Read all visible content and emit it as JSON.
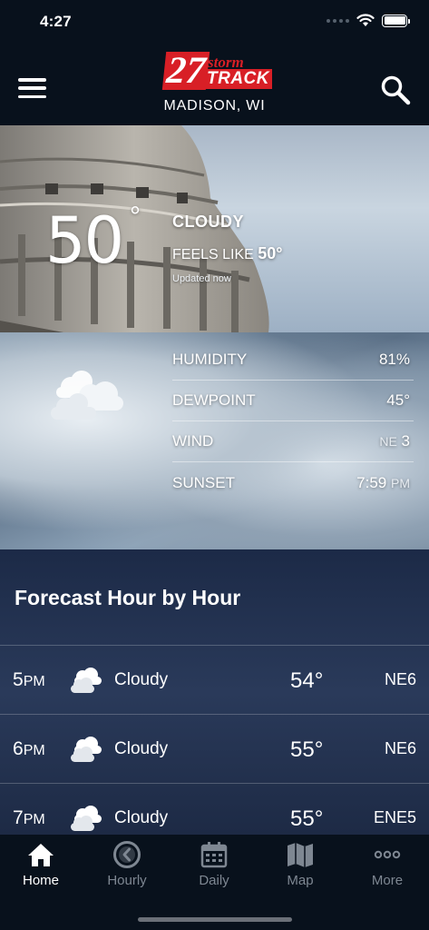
{
  "status_bar": {
    "time": "4:27"
  },
  "header": {
    "logo_number": "27",
    "logo_storm": "storm",
    "logo_track": "TRACK",
    "location": "MADISON, WI"
  },
  "current": {
    "temperature": "50",
    "degree_symbol": "°",
    "condition": "CLOUDY",
    "feels_like_label": "FEELS LIKE",
    "feels_like_value": "50°",
    "updated": "Updated now"
  },
  "details": [
    {
      "label": "HUMIDITY",
      "value": "81%",
      "unit": ""
    },
    {
      "label": "DEWPOINT",
      "value": "45°",
      "unit": ""
    },
    {
      "label": "WIND",
      "value": "3",
      "unit": "NE"
    },
    {
      "label": "SUNSET",
      "value": "7:59",
      "unit": "PM"
    }
  ],
  "forecast": {
    "title": "Forecast Hour by Hour",
    "hours": [
      {
        "hour": "5",
        "ampm": "PM",
        "condition": "Cloudy",
        "temp": "54°",
        "wind": "NE6"
      },
      {
        "hour": "6",
        "ampm": "PM",
        "condition": "Cloudy",
        "temp": "55°",
        "wind": "NE6"
      },
      {
        "hour": "7",
        "ampm": "PM",
        "condition": "Cloudy",
        "temp": "55°",
        "wind": "ENE5"
      }
    ]
  },
  "tabs": [
    {
      "label": "Home",
      "icon": "home-icon",
      "active": true
    },
    {
      "label": "Hourly",
      "icon": "clock-icon",
      "active": false
    },
    {
      "label": "Daily",
      "icon": "calendar-icon",
      "active": false
    },
    {
      "label": "Map",
      "icon": "map-icon",
      "active": false
    },
    {
      "label": "More",
      "icon": "more-icon",
      "active": false
    }
  ],
  "colors": {
    "brand_red": "#d81f26",
    "header_bg": "#08111c",
    "forecast_bg": "#1c2a47",
    "tab_inactive": "#7e8792"
  }
}
